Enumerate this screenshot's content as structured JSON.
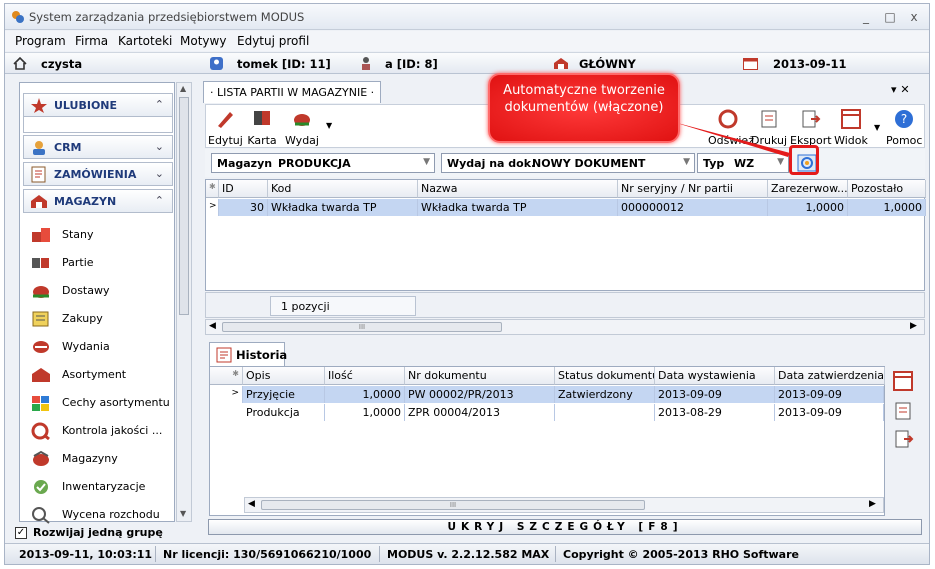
{
  "window": {
    "title": "System zarządzania przedsiębiorstwem MODUS",
    "controls": [
      "_",
      "□",
      "x"
    ]
  },
  "menu": [
    "Program",
    "Firma",
    "Kartoteki",
    "Motywy",
    "Edytuj profil"
  ],
  "infobar": {
    "home": "czysta",
    "user": "tomek [ID: 11]",
    "role": "a [ID: 8]",
    "warehouse": "GŁÓWNY",
    "date": "2013-09-11"
  },
  "sidebar": {
    "groups": [
      {
        "label": "ULUBIONE",
        "chev": "⌃"
      },
      {
        "label": "CRM",
        "chev": "⌄"
      },
      {
        "label": "ZAMÓWIENIA",
        "chev": "⌄"
      },
      {
        "label": "MAGAZYN",
        "chev": "⌃"
      }
    ],
    "items": [
      "Stany",
      "Partie",
      "Dostawy",
      "Zakupy",
      "Wydania",
      "Asortyment",
      "Cechy asortymentu",
      "Kontrola jakości ...",
      "Magazyny",
      "Inwentaryzacje",
      "Wycena rozchodu"
    ],
    "collapse_option": "Rozwijaj jedną grupę",
    "collapse_checked": true
  },
  "tab": {
    "label": "· LISTA PARTII W MAGAZYNIE ·",
    "close": "▾ ✕"
  },
  "toolbar": {
    "left": [
      "Edytuj",
      "Karta",
      "Wydaj"
    ],
    "right": [
      "Odśwież",
      "Drukuj",
      "Eksport",
      "Widok",
      "Pomoc"
    ]
  },
  "callout": {
    "text": "Automatyczne tworzenie dokumentów (włączone)"
  },
  "filters": {
    "warehouse_label": "Magazyn",
    "warehouse_value": "PRODUKCJA",
    "issue_label": "Wydaj na dok.",
    "issue_value": "NOWY DOKUMENT",
    "type_label": "Typ",
    "type_value": "WZ"
  },
  "parties": {
    "columns": [
      "ID",
      "Kod",
      "Nazwa",
      "Nr seryjny / Nr partii",
      "Zarezerwow...",
      "Pozostało"
    ],
    "rows": [
      [
        "30",
        "Wkładka twarda TP",
        "Wkładka twarda TP",
        "000000012",
        "1,0000",
        "1,0000"
      ]
    ],
    "count": "1 pozycji",
    "scroll_glyph": "III"
  },
  "history": {
    "tab_label": "Historia",
    "columns": [
      "Opis",
      "Ilość",
      "Nr dokumentu",
      "Status dokumentu",
      "Data wystawienia",
      "Data zatwierdzenia"
    ],
    "rows": [
      [
        "Przyjęcie",
        "1,0000",
        "PW 00002/PR/2013",
        "Zatwierdzony",
        "2013-09-09",
        "2013-09-09"
      ],
      [
        "Produkcja",
        "1,0000",
        "ZPR 00004/2013",
        "",
        "2013-08-29",
        "2013-09-09"
      ]
    ],
    "scroll_glyph": "III"
  },
  "hide_details": "UKRYJ SZCZEGÓŁY [F8]",
  "status": {
    "datetime": "2013-09-11, 10:03:11",
    "license": "Nr licencji: 130/5691066210/1000",
    "version": "MODUS v. 2.2.12.582 MAX",
    "copyright": "Copyright © 2005-2013 RHO Software"
  },
  "colors": {
    "selection": "#c4d6f2",
    "callout": "#e41b1b",
    "header_text": "#1f3a7a"
  }
}
